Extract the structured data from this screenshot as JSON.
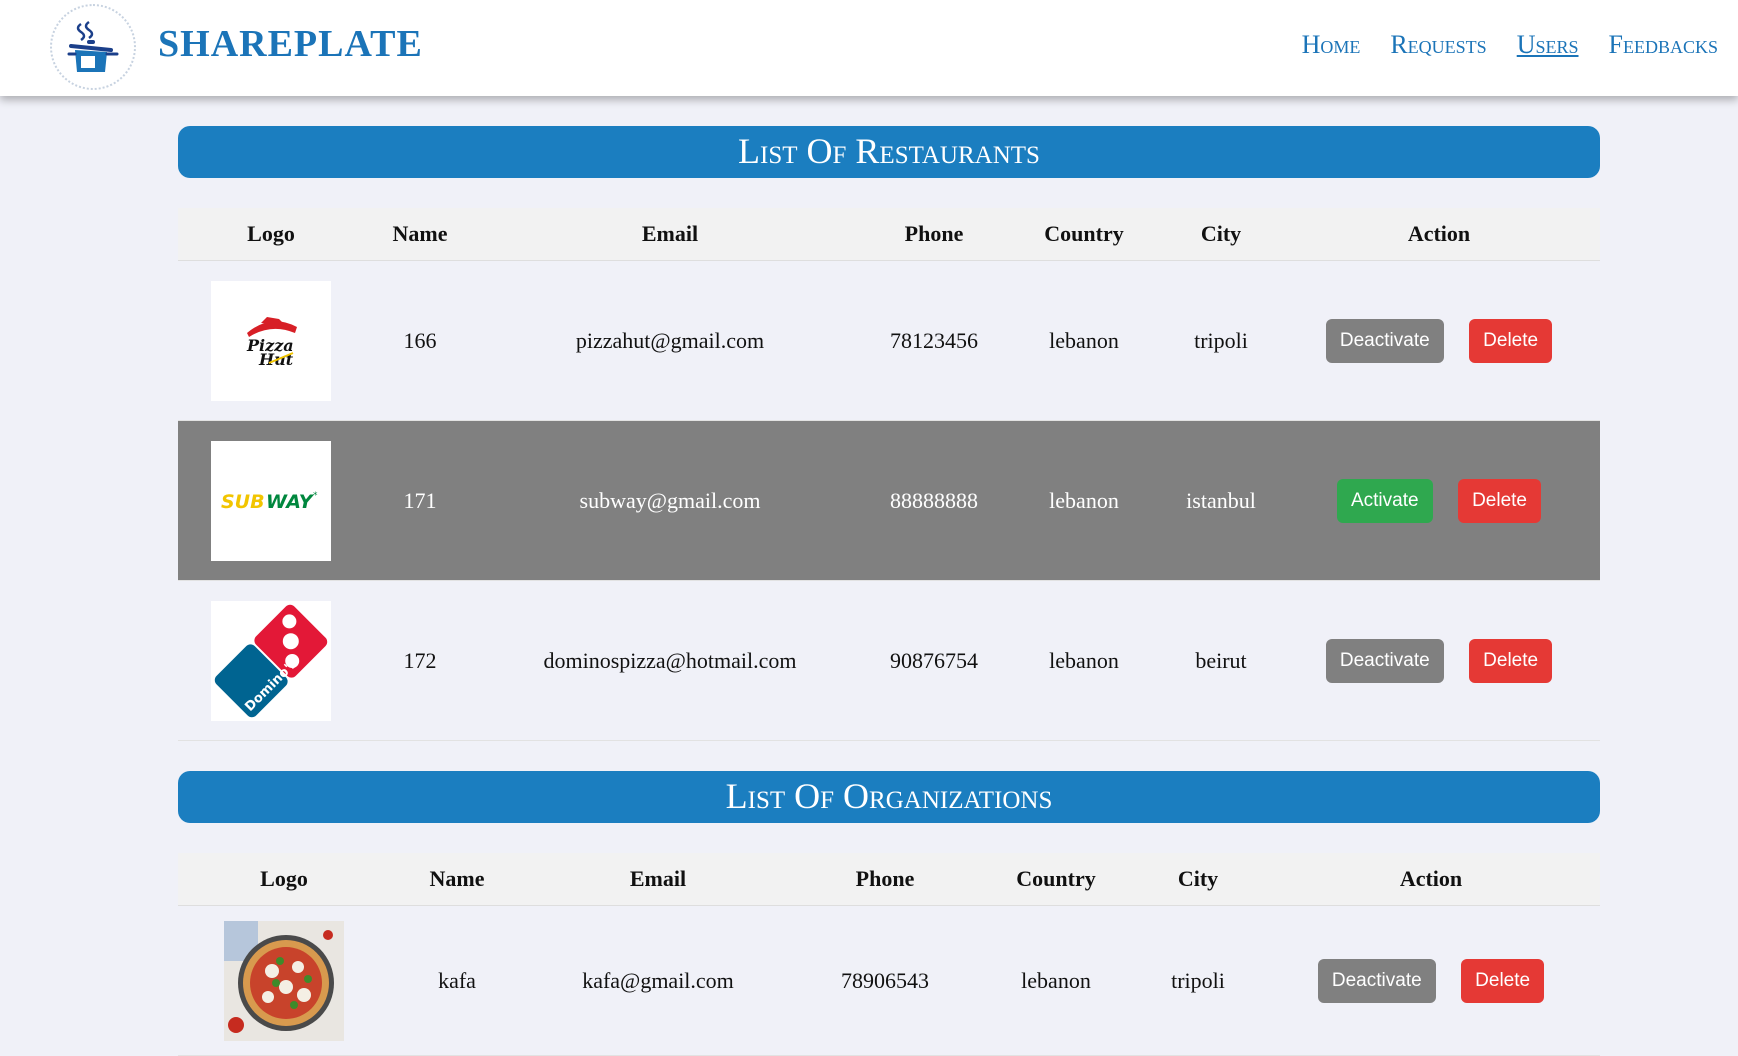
{
  "header": {
    "brand": "SHAREPLATE",
    "nav": [
      {
        "label": "Home",
        "active": false
      },
      {
        "label": "Requests",
        "active": false
      },
      {
        "label": "Users",
        "active": true
      },
      {
        "label": "Feedbacks",
        "active": false
      }
    ]
  },
  "restaurants": {
    "title": "List Of Restaurants",
    "columns": [
      "Logo",
      "Name",
      "Email",
      "Phone",
      "Country",
      "City",
      "Action"
    ],
    "rows": [
      {
        "logo": "pizza-hut-logo",
        "name": "166",
        "email": "pizzahut@gmail.com",
        "phone": "78123456",
        "country": "lebanon",
        "city": "tripoli",
        "toggle": "Deactivate",
        "delete": "Delete",
        "inactive": false
      },
      {
        "logo": "subway-logo",
        "name": "171",
        "email": "subway@gmail.com",
        "phone": "88888888",
        "country": "lebanon",
        "city": "istanbul",
        "toggle": "Activate",
        "delete": "Delete",
        "inactive": true
      },
      {
        "logo": "dominos-logo",
        "name": "172",
        "email": "dominospizza@hotmail.com",
        "phone": "90876754",
        "country": "lebanon",
        "city": "beirut",
        "toggle": "Deactivate",
        "delete": "Delete",
        "inactive": false
      }
    ]
  },
  "organizations": {
    "title": "List Of Organizations",
    "columns": [
      "Logo",
      "Name",
      "Email",
      "Phone",
      "Country",
      "City",
      "Action"
    ],
    "rows": [
      {
        "logo": "pizza-photo",
        "name": "kafa",
        "email": "kafa@gmail.com",
        "phone": "78906543",
        "country": "lebanon",
        "city": "tripoli",
        "toggle": "Deactivate",
        "delete": "Delete",
        "inactive": false
      }
    ]
  },
  "colors": {
    "brand_blue": "#1b74b8",
    "section_bar": "#1b7ec0",
    "inactive_row": "#808080",
    "deactivate_button": "#808080",
    "activate_button": "#2fa84f",
    "delete_button": "#e53935"
  }
}
